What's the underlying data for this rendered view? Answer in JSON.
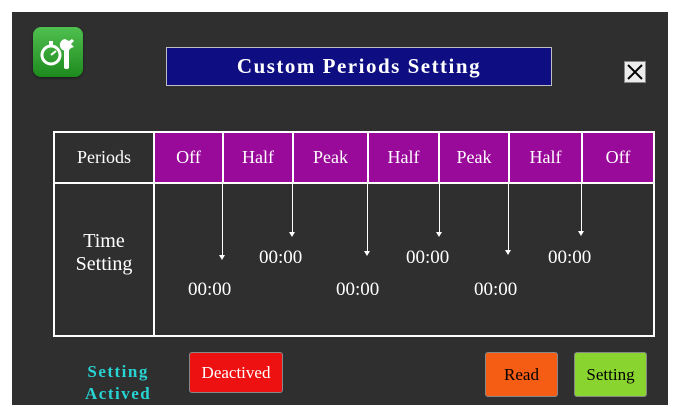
{
  "window": {
    "title": "Custom Periods Setting"
  },
  "icons": {
    "app": "stopwatch-wrench-icon",
    "close": "close-icon"
  },
  "table": {
    "header_label": "Periods",
    "periods": [
      "Off",
      "Half",
      "Peak",
      "Half",
      "Peak",
      "Half",
      "Off"
    ],
    "row_label_line1": "Time",
    "row_label_line2": "Setting",
    "times": [
      "00:00",
      "00:00",
      "00:00",
      "00:00",
      "00:00",
      "00:00"
    ]
  },
  "status": {
    "line1": "Setting",
    "line2": "Actived"
  },
  "buttons": {
    "deactive": "Deactived",
    "read": "Read",
    "setting": "Setting"
  },
  "colors": {
    "panel": "#2f2f2f",
    "title_bg": "#0e0e82",
    "period_bg": "#9a0a9a",
    "status_text": "#27d3d3",
    "deactive": "#ee1111",
    "read": "#f55d14",
    "setting": "#8ad430"
  }
}
